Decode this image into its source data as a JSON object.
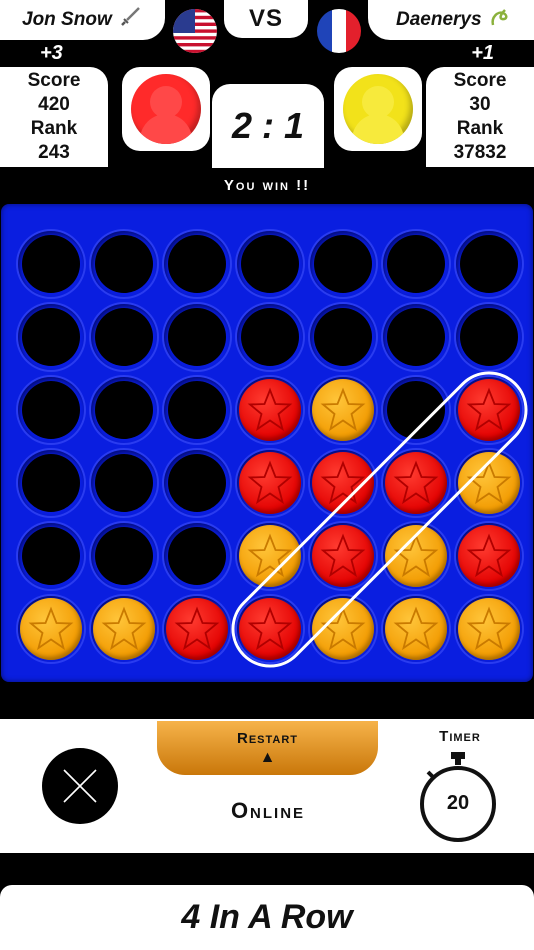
{
  "players": {
    "left": {
      "name": "Jon Snow",
      "icon": "sword-icon",
      "flag": "usa-flag",
      "delta": "+3",
      "score_label": "Score",
      "score": "420",
      "rank_label": "Rank",
      "rank": "243",
      "color": "#ff2a2a"
    },
    "right": {
      "name": "Daenerys",
      "icon": "dragon-icon",
      "flag": "france-flag",
      "delta": "+1",
      "score_label": "Score",
      "score": "30",
      "rank_label": "Rank",
      "rank": "37832",
      "color": "#f2e21a"
    }
  },
  "vs_label": "VS",
  "match_score": "2 : 1",
  "status": "You win !!",
  "board": {
    "rows": 6,
    "cols": 7,
    "cells": [
      [
        "",
        "",
        "",
        "",
        "",
        "",
        ""
      ],
      [
        "",
        "",
        "",
        "",
        "",
        "",
        ""
      ],
      [
        "",
        "",
        "",
        "R",
        "Y",
        "",
        "R"
      ],
      [
        "",
        "",
        "",
        "R",
        "R",
        "R",
        "Y"
      ],
      [
        "",
        "",
        "",
        "Y",
        "R",
        "Y",
        "R"
      ],
      [
        "Y",
        "Y",
        "R",
        "R",
        "Y",
        "Y",
        "Y"
      ]
    ],
    "winning_line": {
      "from": [
        5,
        3
      ],
      "to": [
        2,
        6
      ]
    },
    "colors": {
      "board": "#0a1ee0",
      "red": "#e20000",
      "yellow": "#f29a00"
    }
  },
  "controls": {
    "close_icon": "close-icon",
    "restart_label": "Restart",
    "restart_arrow": "▲",
    "mode_label": "Online",
    "timer_label": "Timer",
    "timer_value": "20"
  },
  "footer_title": "4 In A Row"
}
